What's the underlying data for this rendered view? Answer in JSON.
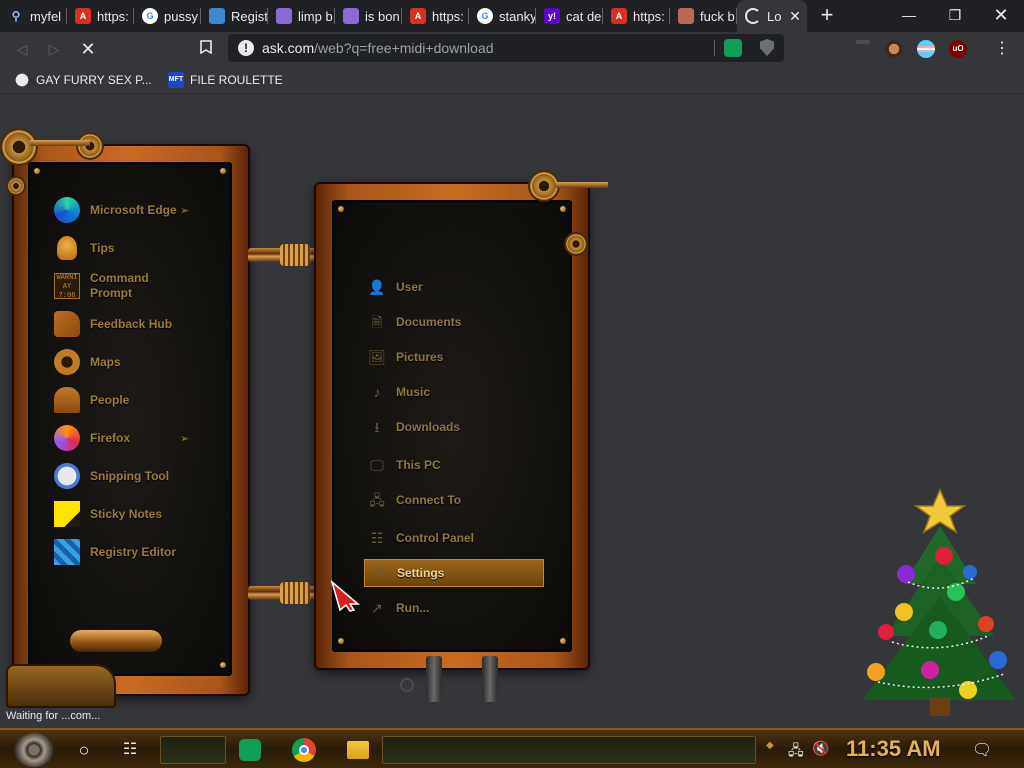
{
  "tabs": [
    {
      "title": "myfel",
      "favicon": "search-icon",
      "color": "#202124"
    },
    {
      "title": "https:",
      "favicon": "acrobat-icon",
      "color": "#d93025"
    },
    {
      "title": "pussy",
      "favicon": "google-icon",
      "color": "#ffffff"
    },
    {
      "title": "Regist",
      "favicon": "registry-icon",
      "color": "#3a8ad6"
    },
    {
      "title": "limp b",
      "favicon": "feather-icon",
      "color": "#8a6bd6"
    },
    {
      "title": "is bon",
      "favicon": "feather-icon",
      "color": "#8a6bd6"
    },
    {
      "title": "https:",
      "favicon": "acrobat-icon",
      "color": "#d93025"
    },
    {
      "title": "stanky",
      "favicon": "google-icon",
      "color": "#ffffff"
    },
    {
      "title": "cat de",
      "favicon": "yahoo-icon",
      "color": "#6001d2"
    },
    {
      "title": "https:",
      "favicon": "acrobat-icon",
      "color": "#d93025"
    },
    {
      "title": "fuck b",
      "favicon": "spiral-icon",
      "color": "#b56b5a"
    },
    {
      "title": "Lo",
      "favicon": "loading-icon",
      "color": "#35363a",
      "active": true
    }
  ],
  "address": {
    "host": "ask.com",
    "path": "/web?q=free+midi+download"
  },
  "bookmarks": [
    {
      "label": "GAY FURRY SEX P...",
      "icon": "globe-icon"
    },
    {
      "label": "FILE ROULETTE",
      "icon": "mft-icon"
    }
  ],
  "start_menu": {
    "apps": [
      {
        "label": "Microsoft Edge",
        "icon": "edge-icon",
        "has_arrow": true
      },
      {
        "label": "Tips",
        "icon": "lightbulb-icon",
        "has_arrow": false
      },
      {
        "label": "Command Prompt",
        "icon": "terminal-icon",
        "has_arrow": false
      },
      {
        "label": "Feedback Hub",
        "icon": "feedback-icon",
        "has_arrow": false
      },
      {
        "label": "Maps",
        "icon": "map-pin-icon",
        "has_arrow": false
      },
      {
        "label": "People",
        "icon": "people-icon",
        "has_arrow": false
      },
      {
        "label": "Firefox",
        "icon": "firefox-icon",
        "has_arrow": true
      },
      {
        "label": "Snipping Tool",
        "icon": "scissors-icon",
        "has_arrow": false
      },
      {
        "label": "Sticky Notes",
        "icon": "sticky-note-icon",
        "has_arrow": false
      },
      {
        "label": "Registry Editor",
        "icon": "registry-icon",
        "has_arrow": false
      }
    ],
    "cmd_icon_text": [
      "WARNI",
      "AY 7:06"
    ],
    "arrow_glyph": "➢",
    "places": [
      {
        "label": "User",
        "icon": "user-icon",
        "glyph": "👤"
      },
      {
        "label": "Documents",
        "icon": "document-icon",
        "glyph": "🗎"
      },
      {
        "label": "Pictures",
        "icon": "picture-icon",
        "glyph": "🖼"
      },
      {
        "label": "Music",
        "icon": "music-icon",
        "glyph": "♪"
      },
      {
        "label": "Downloads",
        "icon": "download-icon",
        "glyph": "⭳"
      },
      {
        "label": "This PC",
        "icon": "monitor-icon",
        "glyph": "🖵"
      },
      {
        "label": "Connect To",
        "icon": "network-icon",
        "glyph": "🖧"
      },
      {
        "label": "Control Panel",
        "icon": "control-panel-icon",
        "glyph": "☷"
      },
      {
        "label": "Settings",
        "icon": "gear-icon",
        "glyph": "⚙",
        "active": true
      },
      {
        "label": "Run...",
        "icon": "run-icon",
        "glyph": "↗"
      }
    ]
  },
  "status_text": "Waiting for ...com...",
  "taskbar": {
    "clock": "11:35 AM",
    "pinned": [
      "hangouts-icon",
      "chrome-icon",
      "file-explorer-icon"
    ]
  }
}
